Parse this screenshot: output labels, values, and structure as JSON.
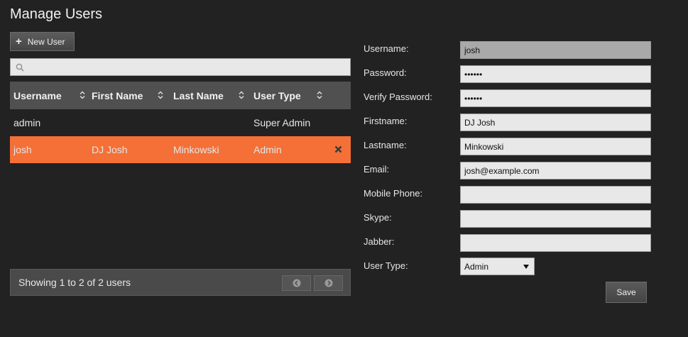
{
  "page": {
    "title": "Manage Users"
  },
  "toolbar": {
    "new_user_label": "New User"
  },
  "search": {
    "value": "",
    "placeholder": ""
  },
  "grid": {
    "columns": [
      {
        "label": "Username"
      },
      {
        "label": "First Name"
      },
      {
        "label": "Last Name"
      },
      {
        "label": "User Type"
      }
    ],
    "rows": [
      {
        "username": "admin",
        "first_name": "",
        "last_name": "",
        "user_type": "Super Admin",
        "selected": false
      },
      {
        "username": "josh",
        "first_name": "DJ Josh",
        "last_name": "Minkowski",
        "user_type": "Admin",
        "selected": true
      }
    ],
    "footer_text": "Showing 1 to 2 of 2 users"
  },
  "form": {
    "username_label": "Username:",
    "username_value": "josh",
    "password_label": "Password:",
    "password_value": "joshjo",
    "verify_password_label": "Verify Password:",
    "verify_password_value": "joshjo",
    "firstname_label": "Firstname:",
    "firstname_value": "DJ Josh",
    "lastname_label": "Lastname:",
    "lastname_value": "Minkowski",
    "email_label": "Email:",
    "email_value": "josh@example.com",
    "mobile_label": "Mobile Phone:",
    "mobile_value": "",
    "skype_label": "Skype:",
    "skype_value": "",
    "jabber_label": "Jabber:",
    "jabber_value": "",
    "user_type_label": "User Type:",
    "user_type_value": "Admin",
    "save_label": "Save"
  },
  "colors": {
    "background": "#222222",
    "selected_row": "#f47037",
    "header": "#505050"
  }
}
